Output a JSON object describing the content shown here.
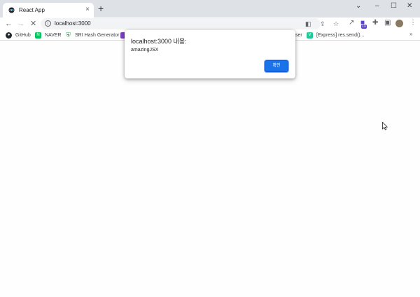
{
  "tab": {
    "title": "React App",
    "close_glyph": "×"
  },
  "new_tab_glyph": "+",
  "window_controls": {
    "minimize": "–",
    "maximize": "☐",
    "close": "✕",
    "menu": "⌄"
  },
  "nav": {
    "back": "←",
    "forward": "→",
    "reload": "✕"
  },
  "omnibox": {
    "info": "i",
    "url": "localhost:3000"
  },
  "toolbar_icons": {
    "translate": "◧",
    "share": "⇪",
    "bookmark_star": "☆",
    "ext1": "↗",
    "extensions": "✚",
    "sidepanel": "▣",
    "menu": "⋮",
    "ext_badge": "13"
  },
  "bookmarks": {
    "items": [
      {
        "label": "GitHub",
        "icon": "github-icon",
        "color": "#24292e",
        "glyph": "●"
      },
      {
        "label": "NAVER",
        "icon": "naver-icon",
        "color": "#03c75a",
        "glyph": "N"
      },
      {
        "label": "SRI Hash Generator",
        "icon": "shield-icon",
        "color": "#34a853",
        "glyph": "⛨"
      },
      {
        "label": "ser",
        "icon": "purple-bookmark-icon",
        "color": "#7b3fc4",
        "glyph": ""
      },
      {
        "label": "[Express] res.send()...",
        "icon": "velog-icon",
        "color": "#20c997",
        "glyph": "V"
      }
    ],
    "more": "»"
  },
  "dialog": {
    "title": "localhost:3000 내용:",
    "message": "amazingJSX",
    "ok_label": "확인"
  },
  "colors": {
    "accent": "#1a73e8",
    "tabstrip": "#dee1e6"
  }
}
